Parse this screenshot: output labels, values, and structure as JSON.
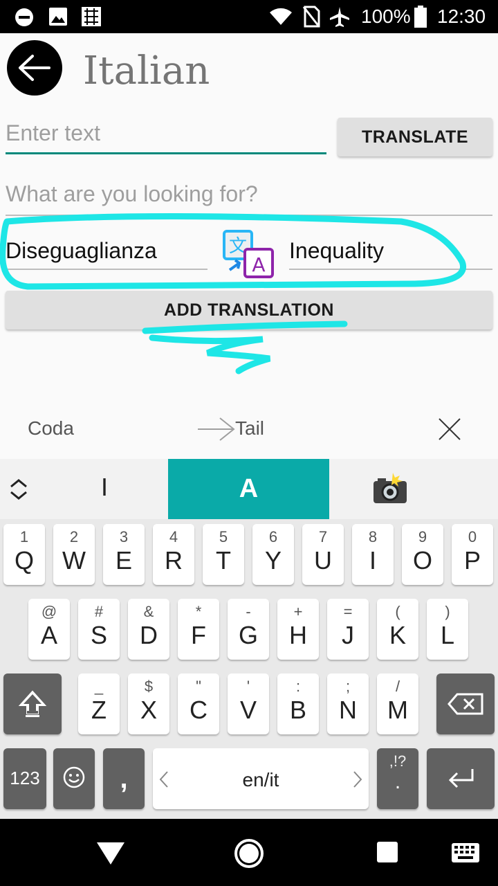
{
  "status": {
    "battery": "100%",
    "time": "12:30"
  },
  "app": {
    "title": "Italian"
  },
  "input": {
    "placeholder": "Enter text",
    "translate_label": "TRANSLATE"
  },
  "search": {
    "placeholder": "What are you looking for?"
  },
  "pair": {
    "source": "Diseguaglianza",
    "target": "Inequality"
  },
  "add_translation_label": "ADD TRANSLATION",
  "history": {
    "source": "Coda",
    "target": "Tail"
  },
  "keyboard": {
    "mode_tabs": [
      "I",
      "A"
    ],
    "row1": [
      {
        "hint": "1",
        "main": "Q"
      },
      {
        "hint": "2",
        "main": "W"
      },
      {
        "hint": "3",
        "main": "E"
      },
      {
        "hint": "4",
        "main": "R"
      },
      {
        "hint": "5",
        "main": "T"
      },
      {
        "hint": "6",
        "main": "Y"
      },
      {
        "hint": "7",
        "main": "U"
      },
      {
        "hint": "8",
        "main": "I"
      },
      {
        "hint": "9",
        "main": "O"
      },
      {
        "hint": "0",
        "main": "P"
      }
    ],
    "row2": [
      {
        "hint": "@",
        "main": "A"
      },
      {
        "hint": "#",
        "main": "S"
      },
      {
        "hint": "&",
        "main": "D"
      },
      {
        "hint": "*",
        "main": "F"
      },
      {
        "hint": "-",
        "main": "G"
      },
      {
        "hint": "+",
        "main": "H"
      },
      {
        "hint": "=",
        "main": "J"
      },
      {
        "hint": "(",
        "main": "K"
      },
      {
        "hint": ")",
        "main": "L"
      }
    ],
    "row3": [
      {
        "hint": "_",
        "main": "Z"
      },
      {
        "hint": "$",
        "main": "X"
      },
      {
        "hint": "\"",
        "main": "C"
      },
      {
        "hint": "'",
        "main": "V"
      },
      {
        "hint": ":",
        "main": "B"
      },
      {
        "hint": ";",
        "main": "N"
      },
      {
        "hint": "/",
        "main": "M"
      }
    ],
    "numbers_label": "123",
    "comma_label": ",",
    "space_label": "en/it",
    "punct_hint": ",!?",
    "punct_main": "."
  },
  "colors": {
    "accent_teal": "#0aaaa8",
    "highlight_cyan": "#1ee6e6",
    "field_underline": "#00897b"
  }
}
